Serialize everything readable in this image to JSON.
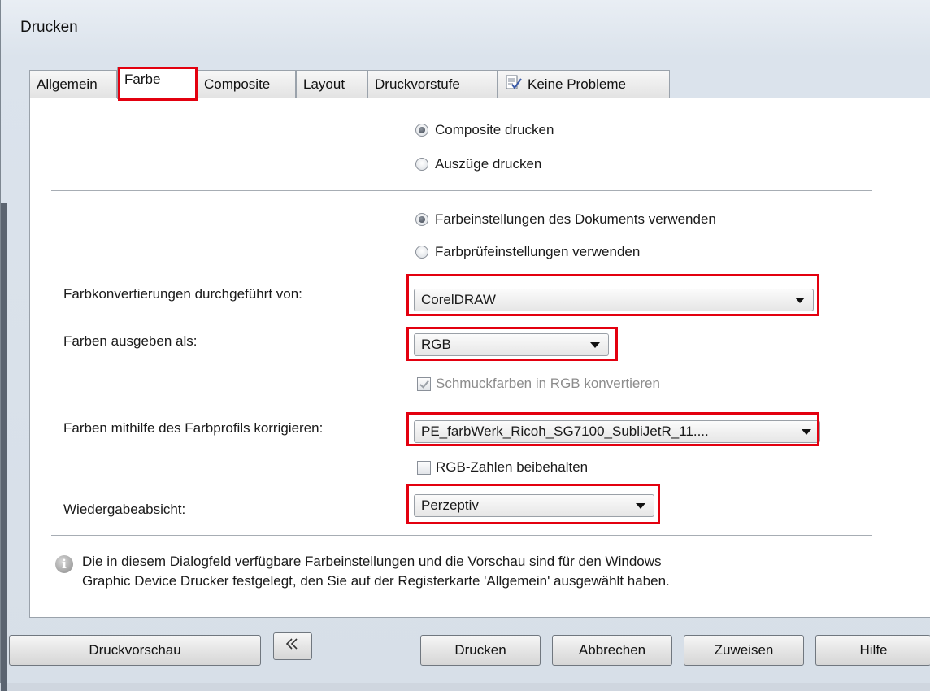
{
  "window": {
    "title": "Drucken"
  },
  "tabs": [
    {
      "label": "Allgemein"
    },
    {
      "label": "Farbe"
    },
    {
      "label": "Composite"
    },
    {
      "label": "Layout"
    },
    {
      "label": "Druckvorstufe"
    },
    {
      "label": "Keine Probleme",
      "icon": "checklist-icon"
    }
  ],
  "print_mode": {
    "composite": "Composite drucken",
    "separations": "Auszüge drucken",
    "selected": "composite"
  },
  "color_settings": {
    "document": "Farbeinstellungen des Dokuments verwenden",
    "proof": "Farbprüfeinstellungen verwenden",
    "selected": "document"
  },
  "conversion": {
    "label": "Farbkonvertierungen durchgeführt von:",
    "value": "CorelDRAW"
  },
  "output": {
    "label": "Farben ausgeben als:",
    "value": "RGB"
  },
  "spot_colors": {
    "label": "Schmuckfarben in RGB konvertieren",
    "checked": true,
    "disabled": true
  },
  "profile": {
    "label": "Farben mithilfe des Farbprofils korrigieren:",
    "value": "PE_farbWerk_Ricoh_SG7100_SubliJetR_11...."
  },
  "keep_rgb": {
    "label": "RGB-Zahlen beibehalten",
    "checked": false
  },
  "intent": {
    "label": "Wiedergabeabsicht:",
    "value": "Perzeptiv"
  },
  "info": {
    "icon": "info-icon",
    "line1": "Die in diesem Dialogfeld verfügbare Farbeinstellungen und die Vorschau sind für den Windows",
    "line2": "Graphic Device Drucker festgelegt, den Sie auf der Registerkarte 'Allgemein' ausgewählt haben."
  },
  "buttons": {
    "preview": "Druckvorschau",
    "collapse_icon": "double-left-arrow-icon",
    "print": "Drucken",
    "cancel": "Abbrechen",
    "apply": "Zuweisen",
    "help": "Hilfe"
  },
  "highlight_color": "#e3000f"
}
